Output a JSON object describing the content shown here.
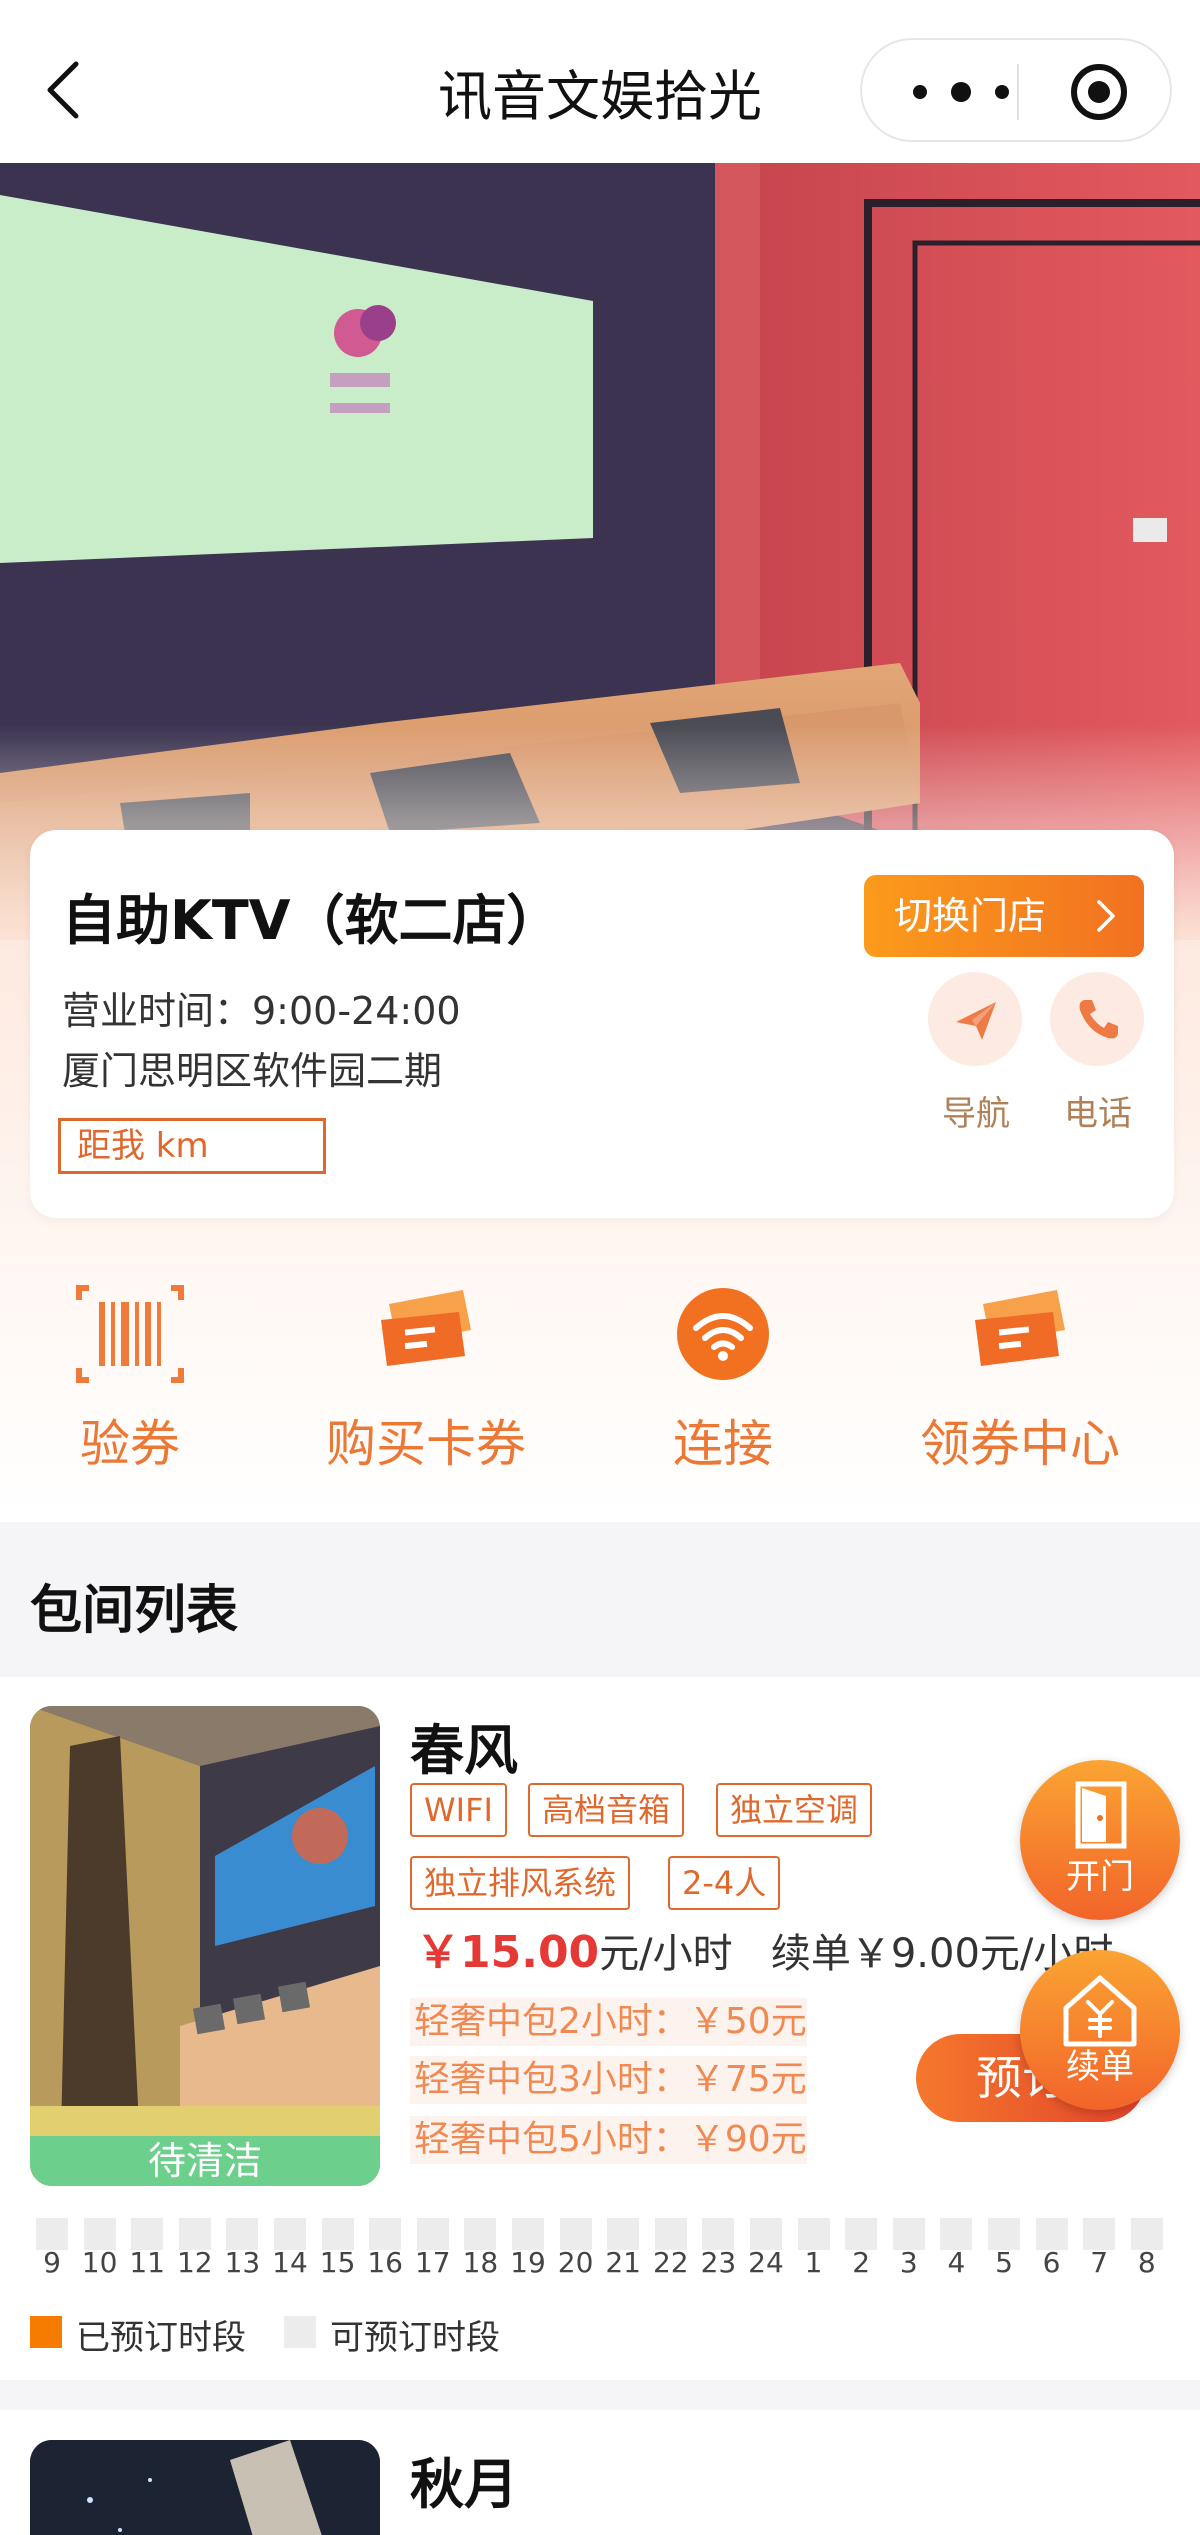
{
  "navbar": {
    "title": "讯音文娱拾光"
  },
  "store": {
    "name": "自助KTV（软二店）",
    "switch_label": "切换门店",
    "hours": "营业时间：9:00-24:00",
    "address": "厦门思明区软件园二期",
    "distance": "距我 km",
    "nav_label": "导航",
    "phone_label": "电话"
  },
  "quick_actions": [
    {
      "label": "验券",
      "icon": "barcode-icon"
    },
    {
      "label": "购买卡券",
      "icon": "ticket-icon"
    },
    {
      "label": "连接",
      "icon": "wifi-icon"
    },
    {
      "label": "领券中心",
      "icon": "ticket-icon"
    }
  ],
  "rooms_section": {
    "title": "包间列表"
  },
  "room1": {
    "name": "春风",
    "status": "待清洁",
    "tags": [
      "WIFI",
      "高档音箱",
      "独立空调",
      "独立排风系统",
      "2-4人"
    ],
    "price": "￥15.00",
    "price_unit": "元/小时",
    "renew_text": "续单￥9.00元/小时",
    "packages": [
      "轻奢中包2小时：￥50元",
      "轻奢中包3小时：￥75元",
      "轻奢中包5小时：￥90元"
    ],
    "book_label": "预订",
    "open_door_label": "开门",
    "renew_label": "续单"
  },
  "timeline": {
    "hours": [
      "9",
      "10",
      "11",
      "12",
      "13",
      "14",
      "15",
      "16",
      "17",
      "18",
      "19",
      "20",
      "21",
      "22",
      "23",
      "24",
      "1",
      "2",
      "3",
      "4",
      "5",
      "6",
      "7",
      "8"
    ],
    "booked_label": "已预订时段",
    "available_label": "可预订时段",
    "booked_color": "#f57c00",
    "available_color": "#ececec"
  },
  "room2": {
    "name": "秋月"
  },
  "colors": {
    "accent": "#f27121",
    "tag": "#e0682c",
    "price": "#e53935",
    "status_green": "#6ccf8b"
  }
}
